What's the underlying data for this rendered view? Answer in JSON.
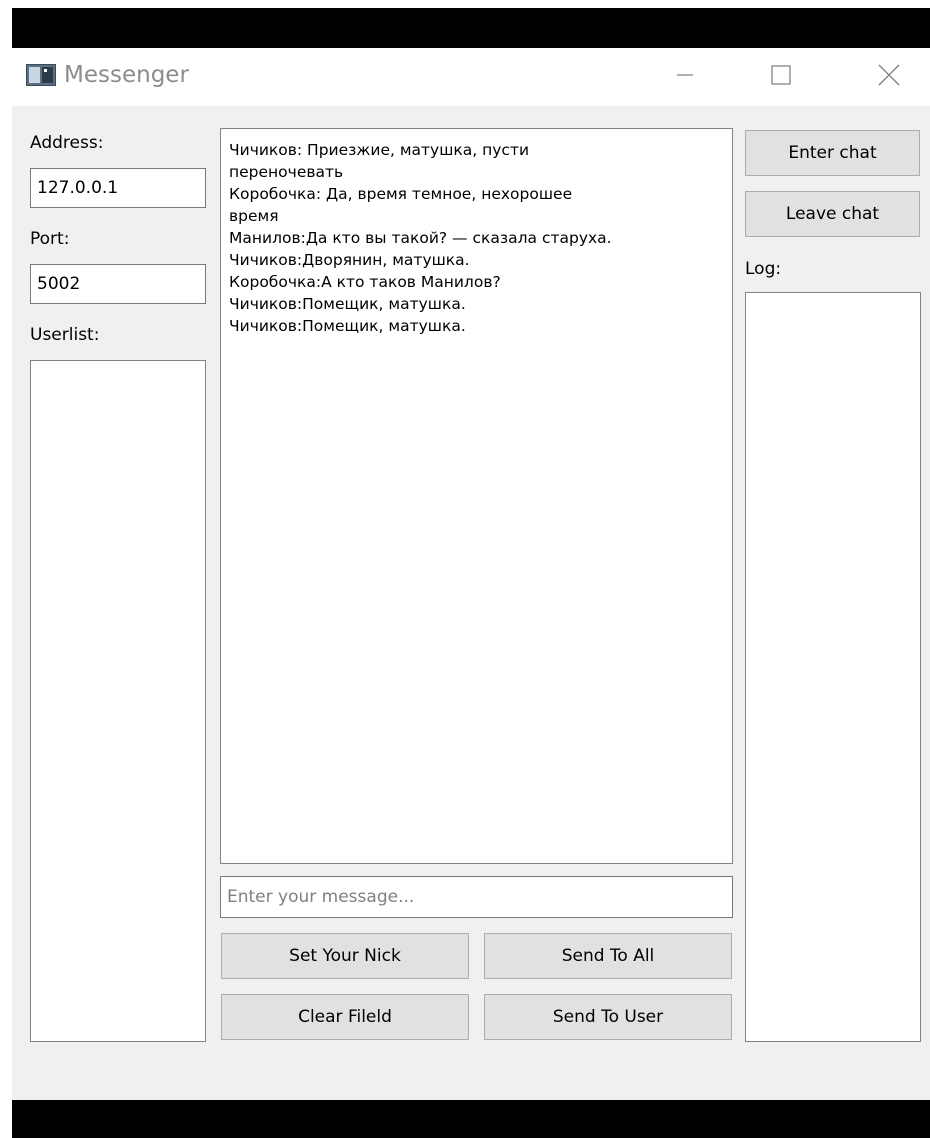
{
  "window": {
    "title": "Messenger"
  },
  "left_panel": {
    "address_label": "Address:",
    "address_value": "127.0.0.1",
    "port_label": "Port:",
    "port_value": "5002",
    "userlist_label": "Userlist:"
  },
  "chat": {
    "lines": [
      "Чичиков: Приезжие, матушка, пусти",
      "переночевать",
      "Коробочка: Да, время темное, нехорошее",
      "время",
      "Манилов:Да кто вы такой? — сказала старуха.",
      "Чичиков:Дворянин, матушка.",
      "Коробочка:А кто таков Манилов?",
      "Чичиков:Помещик, матушка.",
      "Чичиков:Помещик, матушка."
    ],
    "input_placeholder": "Enter your message..."
  },
  "buttons": {
    "set_nick": "Set Your Nick",
    "send_all": "Send To All",
    "clear_field": "Clear Fileld",
    "send_user": "Send To User",
    "enter_chat": "Enter chat",
    "leave_chat": "Leave chat"
  },
  "right_panel": {
    "log_label": "Log:"
  },
  "icons": {
    "app": "app-window-icon",
    "minimize": "minimize-icon",
    "maximize": "maximize-icon",
    "close": "close-icon"
  }
}
